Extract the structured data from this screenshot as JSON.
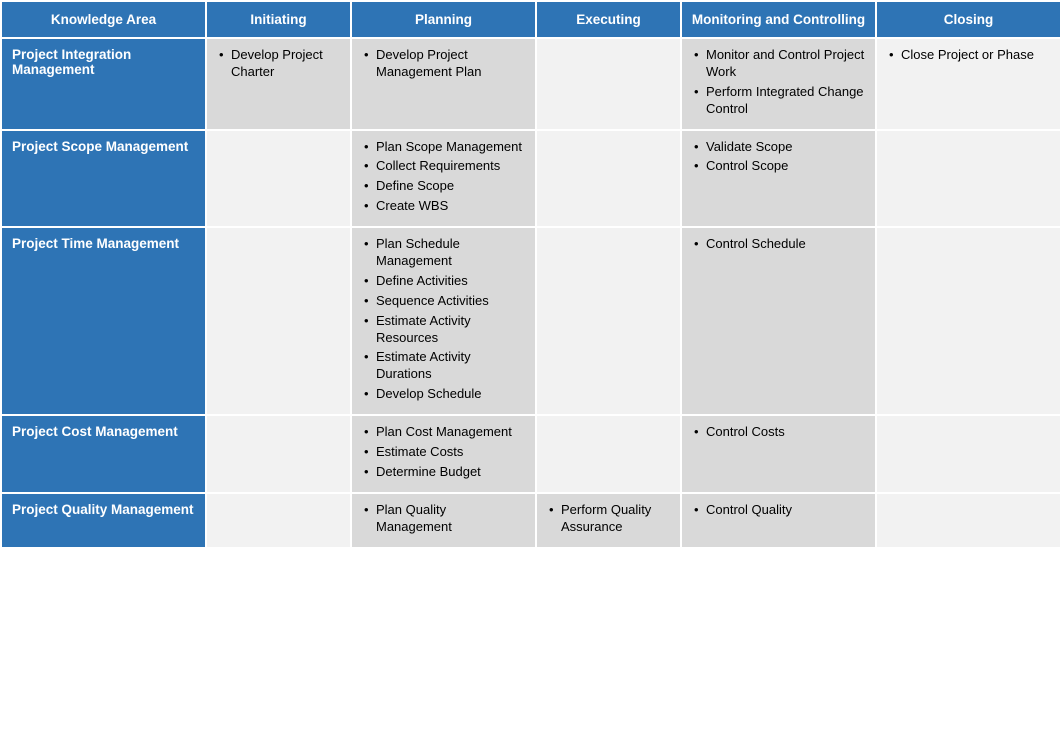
{
  "header": {
    "knowledge_area": "Knowledge Area",
    "initiating": "Initiating",
    "planning": "Planning",
    "executing": "Executing",
    "monitoring": "Monitoring and Controlling",
    "closing": "Closing"
  },
  "rows": [
    {
      "knowledge_area": "Project Integration Management",
      "initiating": [
        "Develop Project Charter"
      ],
      "planning": [
        "Develop Project Management Plan"
      ],
      "executing": [],
      "monitoring": [
        "Monitor and Control Project Work",
        "Perform Integrated Change Control"
      ],
      "closing": [
        "Close Project or Phase"
      ]
    },
    {
      "knowledge_area": "Project Scope Management",
      "initiating": [],
      "planning": [
        "Plan Scope Management",
        "Collect Requirements",
        "Define Scope",
        "Create WBS"
      ],
      "executing": [],
      "monitoring": [
        "Validate Scope",
        "Control Scope"
      ],
      "closing": []
    },
    {
      "knowledge_area": "Project Time Management",
      "initiating": [],
      "planning": [
        "Plan Schedule Management",
        "Define Activities",
        "Sequence Activities",
        "Estimate Activity Resources",
        "Estimate Activity Durations",
        "Develop Schedule"
      ],
      "executing": [],
      "monitoring": [
        "Control Schedule"
      ],
      "closing": []
    },
    {
      "knowledge_area": "Project Cost Management",
      "initiating": [],
      "planning": [
        "Plan Cost Management",
        "Estimate Costs",
        "Determine Budget"
      ],
      "executing": [],
      "monitoring": [
        "Control Costs"
      ],
      "closing": []
    },
    {
      "knowledge_area": "Project Quality Management",
      "initiating": [],
      "planning": [
        "Plan Quality Management"
      ],
      "executing": [
        "Perform Quality Assurance"
      ],
      "monitoring": [
        "Control Quality"
      ],
      "closing": []
    }
  ]
}
